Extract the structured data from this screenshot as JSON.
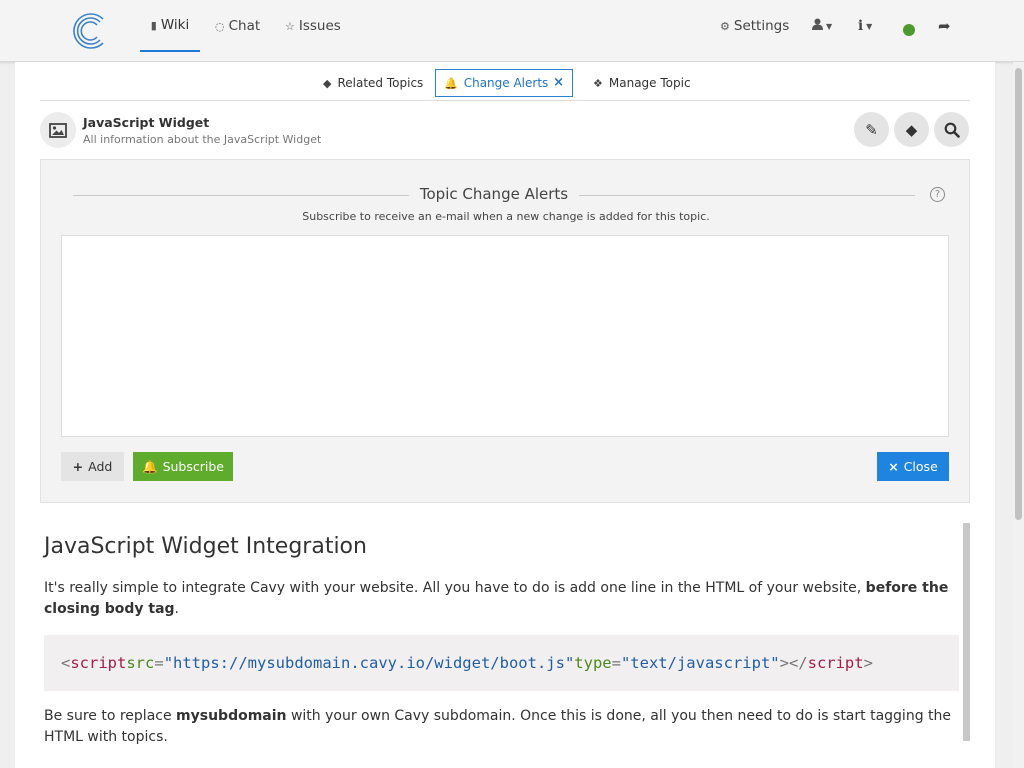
{
  "nav": {
    "logo_alt": "C",
    "wiki": "Wiki",
    "chat": "Chat",
    "issues": "Issues",
    "settings": "Settings",
    "status_color": "#4b9b2c"
  },
  "subnav": {
    "related": "Related Topics",
    "alerts": "Change Alerts",
    "manage": "Manage Topic"
  },
  "topic": {
    "title": "JavaScript Widget",
    "subtitle": "All information about the JavaScript Widget"
  },
  "panel": {
    "title": "Topic Change Alerts",
    "description": "Subscribe to receive an e-mail when a new change is added for this topic.",
    "add_label": "Add",
    "subscribe_label": "Subscribe",
    "close_label": "Close"
  },
  "article": {
    "title": "JavaScript Widget Integration",
    "p1_a": "It's really simple to integrate Cavy with your website. All you have to do is add one line in the HTML of your website, ",
    "p1_b": "before the closing body tag",
    "p1_c": ".",
    "code": {
      "tag_open": "script",
      "attr_src": "src",
      "src_val": "\"https://mysubdomain.cavy.io/widget/boot.js\"",
      "attr_type": "type",
      "type_val": "\"text/javascript\"",
      "tag_close": "script"
    },
    "p3_a": "Be sure to replace ",
    "p3_b": "mysubdomain",
    "p3_c": " with your own Cavy subdomain. Once this is done, all you then need to do is start tagging the HTML with topics."
  },
  "colors": {
    "accent": "#1f84e0",
    "subscribe": "#5fac2c"
  }
}
